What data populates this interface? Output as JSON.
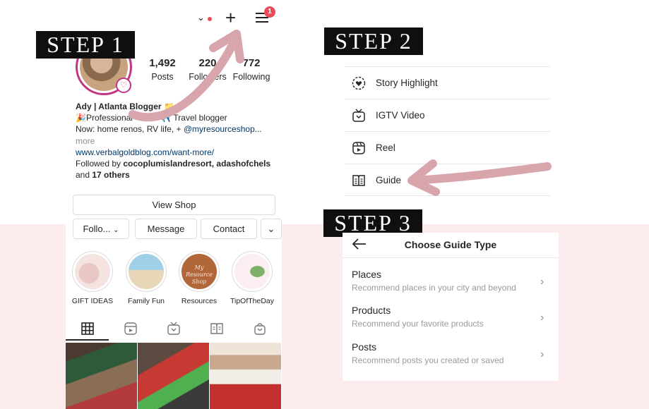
{
  "steps": {
    "step1": "STEP 1",
    "step2": "STEP 2",
    "step3": "STEP 3"
  },
  "profile": {
    "notification_count": "1",
    "stats": [
      {
        "value": "1,492",
        "label": "Posts"
      },
      {
        "value": "220",
        "label": "Followers"
      },
      {
        "value": "772",
        "label": "Following"
      }
    ],
    "bio": {
      "name": "Ady | Atlanta Blogger",
      "line2": "🎉Professional",
      "line2b": "✈️ Travel blogger",
      "line3": "Now: home renos, RV life, +",
      "mention": "@myresourceshop...",
      "more": "more",
      "link": "www.verbalgoldblog.com/want-more/",
      "followed_prefix": "Followed by",
      "followed_users": "cocoplumislandresort, adashofchels",
      "followed_and": "and",
      "followed_others": "17 others"
    },
    "view_shop": "View Shop",
    "buttons": {
      "follow": "Follo...",
      "message": "Message",
      "contact": "Contact"
    },
    "highlights": [
      {
        "label": "GIFT IDEAS"
      },
      {
        "label": "Family Fun"
      },
      {
        "label": "Resources",
        "text": "My Resource Shop"
      },
      {
        "label": "TipOfTheDay"
      }
    ]
  },
  "create_menu": {
    "items": [
      {
        "label": "Story Highlight",
        "icon": "story-highlight-icon"
      },
      {
        "label": "IGTV Video",
        "icon": "igtv-icon"
      },
      {
        "label": "Reel",
        "icon": "reel-icon"
      },
      {
        "label": "Guide",
        "icon": "guide-icon"
      }
    ]
  },
  "guide_types": {
    "title": "Choose Guide Type",
    "options": [
      {
        "title": "Places",
        "subtitle": "Recommend places in your city and beyond"
      },
      {
        "title": "Products",
        "subtitle": "Recommend your favorite products"
      },
      {
        "title": "Posts",
        "subtitle": "Recommend posts you created or saved"
      }
    ]
  },
  "colors": {
    "accent_red": "#ed4956",
    "arrow_pink": "#d9a5ad",
    "band_pink": "#fdecee",
    "step_bg": "#0f0f0f"
  }
}
